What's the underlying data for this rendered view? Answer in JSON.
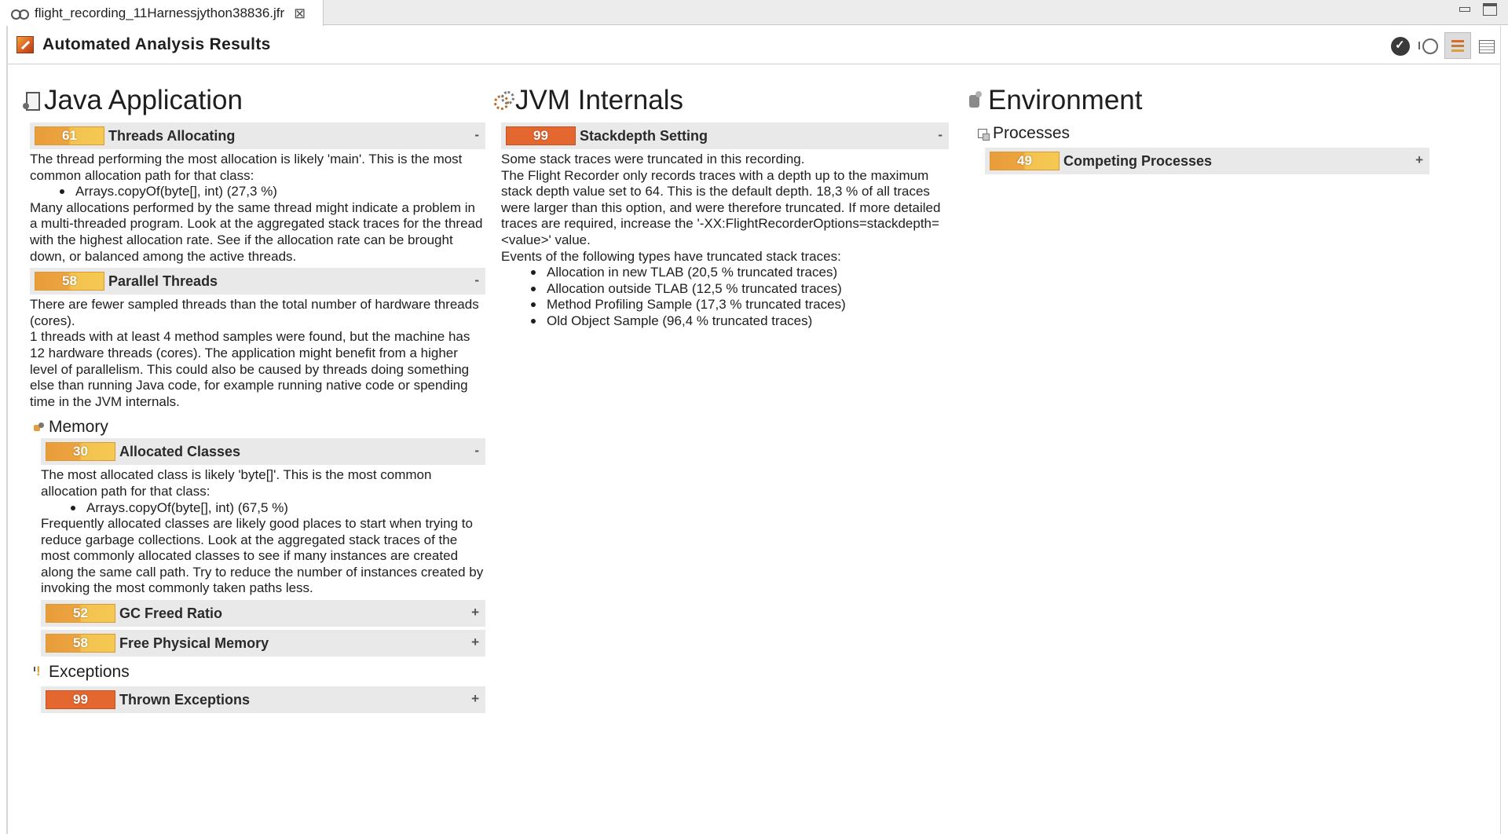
{
  "editor_tab": {
    "title": "flight_recording_11Harnessjython38836.jfr",
    "close": "⊠"
  },
  "header": {
    "title": "Automated Analysis Results"
  },
  "java": {
    "title": "Java Application",
    "threads_allocating": {
      "score": "61",
      "name": "Threads Allocating",
      "toggle": "-",
      "p1": "The thread performing the most allocation is likely 'main'. This is the most common allocation path for that class:",
      "bullet": "Arrays.copyOf(byte[], int) (27,3 %)",
      "p2": "Many allocations performed by the same thread might indicate a problem in a multi-threaded program. Look at the aggregated stack traces for the thread with the highest allocation rate. See if the allocation rate can be brought down, or balanced among the active threads."
    },
    "parallel_threads": {
      "score": "58",
      "name": "Parallel Threads",
      "toggle": "-",
      "p1": "There are fewer sampled threads than the total number of hardware threads (cores).",
      "p2": "1 threads with at least 4 method samples were found, but the machine has 12 hardware threads (cores). The application might benefit from a higher level of parallelism. This could also be caused by threads doing something else than running Java code, for example running native code or spending time in the JVM internals."
    },
    "memory": {
      "title": "Memory",
      "allocated_classes": {
        "score": "30",
        "name": "Allocated Classes",
        "toggle": "-",
        "p1": "The most allocated class is likely 'byte[]'. This is the most common allocation path for that class:",
        "bullet": "Arrays.copyOf(byte[], int) (67,5 %)",
        "p2": "Frequently allocated classes are likely good places to start when trying to reduce garbage collections. Look at the aggregated stack traces of the most commonly allocated classes to see if many instances are created along the same call path. Try to reduce the number of instances created by invoking the most commonly taken paths less."
      },
      "gc_freed_ratio": {
        "score": "52",
        "name": "GC Freed Ratio",
        "toggle": "+"
      },
      "free_physical_memory": {
        "score": "58",
        "name": "Free Physical Memory",
        "toggle": "+"
      }
    },
    "exceptions": {
      "title": "Exceptions",
      "thrown_exceptions": {
        "score": "99",
        "name": "Thrown Exceptions",
        "toggle": "+"
      }
    }
  },
  "jvm": {
    "title": "JVM Internals",
    "stackdepth": {
      "score": "99",
      "name": "Stackdepth Setting",
      "toggle": "-",
      "p1": "Some stack traces were truncated in this recording.",
      "p2": "The Flight Recorder only records traces with a depth up to the maximum stack depth value set to 64. This is the default depth. 18,3 % of all traces were larger than this option, and were therefore truncated. If more detailed traces are required, increase the '-XX:FlightRecorderOptions=stackdepth=<value>' value.",
      "p3": "Events of the following types have truncated stack traces:",
      "bullets": [
        "Allocation in new TLAB (20,5 % truncated traces)",
        "Allocation outside TLAB (12,5 % truncated traces)",
        "Method Profiling Sample (17,3 % truncated traces)",
        "Old Object Sample (96,4 % truncated traces)"
      ]
    }
  },
  "env": {
    "title": "Environment",
    "processes": {
      "title": "Processes",
      "competing": {
        "score": "49",
        "name": "Competing Processes",
        "toggle": "+"
      }
    }
  },
  "colors": {
    "score_high": "#e4672f",
    "score_medium": "#eda43f",
    "rule_bg": "#e9e9e9"
  },
  "icons": [
    "recording-icon",
    "analysis-icon",
    "check-icon",
    "history-icon",
    "report-icon",
    "table-icon",
    "java-app-icon",
    "jvm-icon",
    "environment-icon",
    "memory-icon",
    "exceptions-icon",
    "processes-icon"
  ]
}
